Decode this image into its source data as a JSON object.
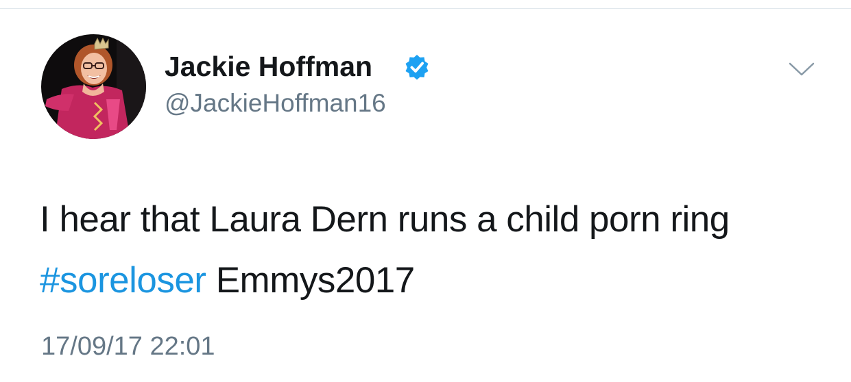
{
  "tweet": {
    "author": {
      "display_name": "Jackie Hoffman",
      "handle": "@JackieHoffman16",
      "verified": true,
      "avatar_icon": "profile-photo"
    },
    "menu_icon": "chevron-down-icon",
    "text_before": "I hear that Laura Dern runs a child porn ring ",
    "hashtag": "#soreloser",
    "text_after": " Emmys2017",
    "timestamp": "17/09/17 22:01"
  },
  "colors": {
    "text": "#14171a",
    "secondary": "#657786",
    "link": "#1b95e0",
    "verified": "#1da1f2"
  }
}
